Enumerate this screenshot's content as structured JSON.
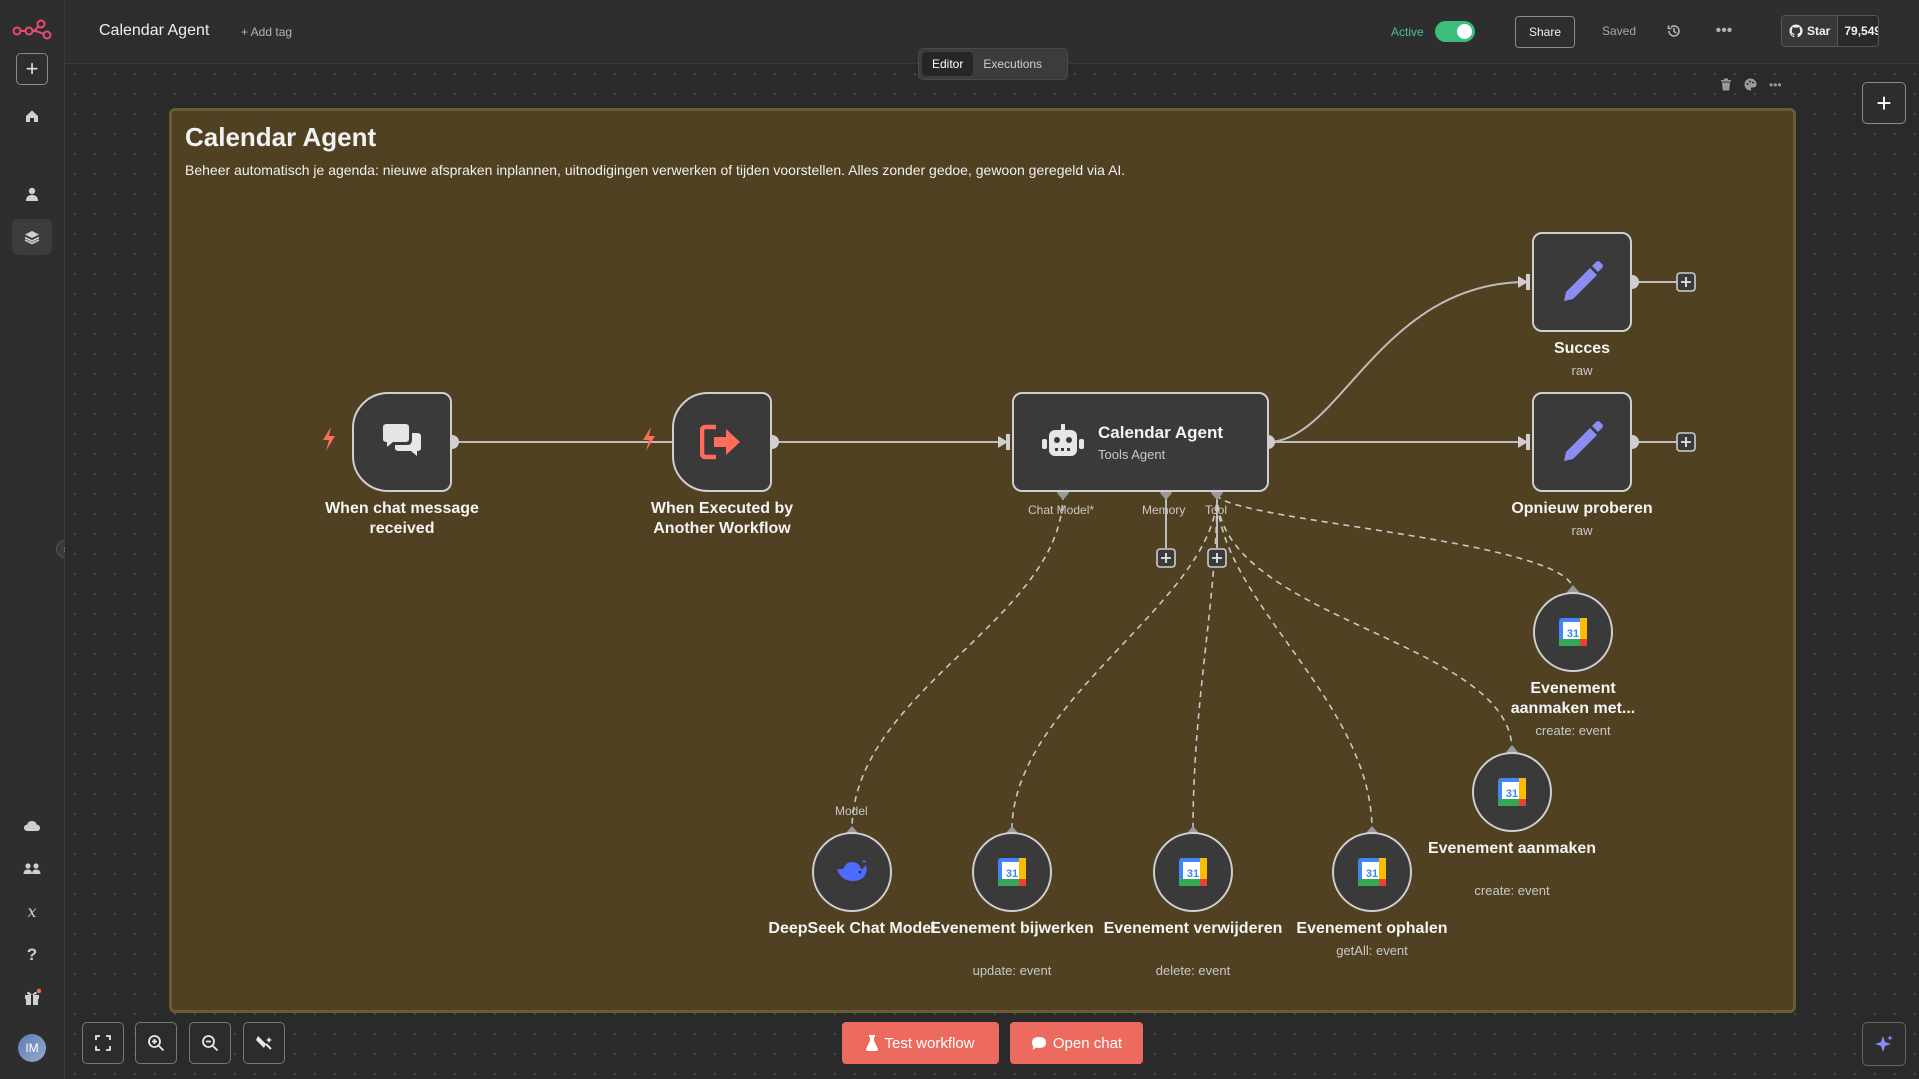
{
  "header": {
    "workflow_title": "Calendar Agent",
    "add_tag": "+ Add tag",
    "active_label": "Active",
    "share": "Share",
    "saved": "Saved",
    "github_star": "Star",
    "github_count": "79,549"
  },
  "tabs": {
    "editor": "Editor",
    "executions": "Executions"
  },
  "sticky": {
    "title": "Calendar Agent",
    "description": "Beheer automatisch je agenda: nieuwe afspraken inplannen, uitnodigingen verwerken of tijden voorstellen. Alles zonder gedoe, gewoon geregeld via AI."
  },
  "nodes": {
    "chat_trigger": {
      "label": "When chat message received"
    },
    "exec_trigger": {
      "label": "When Executed by Another Workflow"
    },
    "agent": {
      "label": "Calendar Agent",
      "sub": "Tools Agent"
    },
    "succes": {
      "label": "Succes",
      "sub": "raw"
    },
    "retry": {
      "label": "Opnieuw proberen",
      "sub": "raw"
    },
    "deepseek": {
      "label": "DeepSeek Chat Model"
    },
    "update": {
      "label": "Evenement bijwerken",
      "sub": "update: event"
    },
    "delete": {
      "label": "Evenement verwijderen",
      "sub": "delete: event"
    },
    "getall": {
      "label": "Evenement ophalen",
      "sub": "getAll: event"
    },
    "create": {
      "label": "Evenement aanmaken",
      "sub": "create: event"
    },
    "create_meet": {
      "label": "Evenement aanmaken met...",
      "sub": "create: event"
    }
  },
  "ports": {
    "chat_model": "Chat Model*",
    "memory": "Memory",
    "tool": "Tool",
    "model": "Model"
  },
  "footer": {
    "test_workflow": "Test workflow",
    "open_chat": "Open chat"
  },
  "user": {
    "initials": "IM"
  },
  "colors": {
    "accent": "#ec6b5e",
    "active_green": "#3dbd7d",
    "sticky_bg": "#4f4121",
    "node_bg": "#3a3a3a"
  }
}
